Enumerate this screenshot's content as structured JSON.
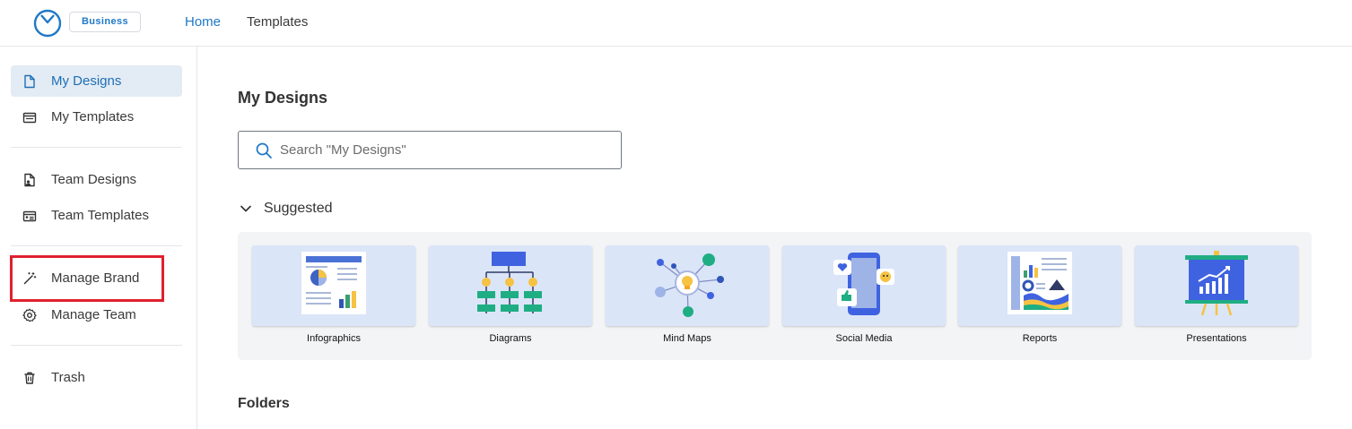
{
  "header": {
    "plan_badge": "Business",
    "nav": [
      {
        "label": "Home",
        "active": true
      },
      {
        "label": "Templates",
        "active": false
      }
    ],
    "accent_color": "#1f78c8"
  },
  "sidebar": {
    "items": [
      {
        "label": "My Designs",
        "icon": "document-icon",
        "active": true
      },
      {
        "label": "My Templates",
        "icon": "template-icon",
        "active": false
      },
      {
        "label": "Team Designs",
        "icon": "team-document-icon",
        "active": false
      },
      {
        "label": "Team Templates",
        "icon": "team-template-icon",
        "active": false
      },
      {
        "label": "Manage Brand",
        "icon": "magic-wand-icon",
        "active": false,
        "highlighted": true
      },
      {
        "label": "Manage Team",
        "icon": "gear-icon",
        "active": false
      },
      {
        "label": "Trash",
        "icon": "trash-icon",
        "active": false
      }
    ],
    "highlight_color": "#e0202e"
  },
  "main": {
    "title": "My Designs",
    "search": {
      "placeholder": "Search \"My Designs\"",
      "value": ""
    },
    "suggested": {
      "label": "Suggested",
      "expanded": true,
      "cards": [
        {
          "label": "Infographics",
          "icon": "infographic-illustration"
        },
        {
          "label": "Diagrams",
          "icon": "diagram-illustration"
        },
        {
          "label": "Mind Maps",
          "icon": "mind-map-illustration"
        },
        {
          "label": "Social Media",
          "icon": "social-media-illustration"
        },
        {
          "label": "Reports",
          "icon": "report-illustration"
        },
        {
          "label": "Presentations",
          "icon": "presentation-illustration"
        }
      ]
    },
    "folders_label": "Folders"
  }
}
